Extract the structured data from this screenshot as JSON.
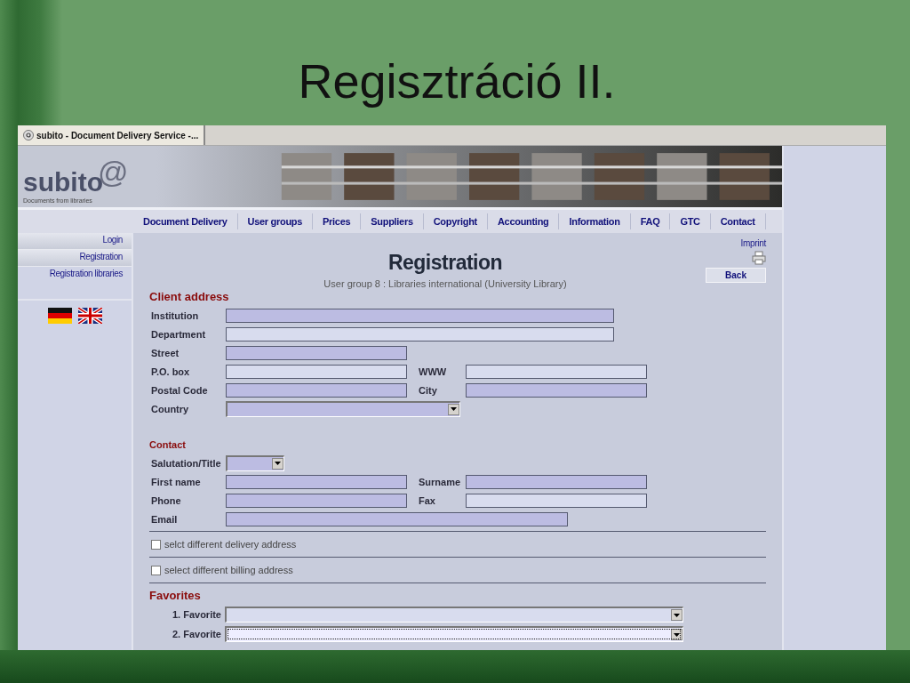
{
  "slide_title": "Regisztráció II.",
  "browser_tab": {
    "title": "subito - Document Delivery Service -..."
  },
  "site": {
    "logo": "subito",
    "logo_mark": "@",
    "tagline": "Documents from libraries"
  },
  "nav": [
    "Document Delivery",
    "User groups",
    "Prices",
    "Suppliers",
    "Copyright",
    "Accounting",
    "Information",
    "FAQ",
    "GTC",
    "Contact"
  ],
  "sidebar": [
    {
      "label": "Login",
      "shaded": true
    },
    {
      "label": "Registration",
      "shaded": true
    },
    {
      "label": "Registration libraries",
      "shaded": false
    }
  ],
  "content": {
    "heading": "Registration",
    "subheading": "User group 8 : Libraries international (University Library)",
    "imprint": "Imprint",
    "back_button": "Back"
  },
  "client_address": {
    "title": "Client address",
    "rows": [
      [
        {
          "label": "Institution",
          "kind": "wide",
          "required": true
        }
      ],
      [
        {
          "label": "Department",
          "kind": "wide",
          "required": false
        }
      ],
      [
        {
          "label": "Street",
          "kind": "half",
          "required": true
        }
      ],
      [
        {
          "label": "P.O. box",
          "kind": "half",
          "required": false
        },
        {
          "label": "WWW",
          "kind": "half",
          "required": false
        }
      ],
      [
        {
          "label": "Postal Code",
          "kind": "half",
          "required": true
        },
        {
          "label": "City",
          "kind": "half",
          "required": true
        }
      ],
      [
        {
          "label": "Country",
          "kind": "select",
          "required": true
        }
      ]
    ]
  },
  "contact": {
    "title": "Contact",
    "rows": [
      [
        {
          "label": "Salutation/Title",
          "kind": "select-small",
          "required": true
        }
      ],
      [
        {
          "label": "First name",
          "kind": "half",
          "required": true
        },
        {
          "label": "Surname",
          "kind": "half",
          "required": true
        }
      ],
      [
        {
          "label": "Phone",
          "kind": "half",
          "required": true
        },
        {
          "label": "Fax",
          "kind": "half",
          "required": false
        }
      ],
      [
        {
          "label": "Email",
          "kind": "medium",
          "required": true
        }
      ]
    ]
  },
  "options": [
    {
      "label": "selct different delivery address",
      "checked": false
    },
    {
      "label": "select different billing address",
      "checked": false
    }
  ],
  "favorites": {
    "title": "Favorites",
    "items": [
      {
        "label": "1. Favorite",
        "focused": false
      },
      {
        "label": "2. Favorite",
        "focused": true
      }
    ]
  }
}
